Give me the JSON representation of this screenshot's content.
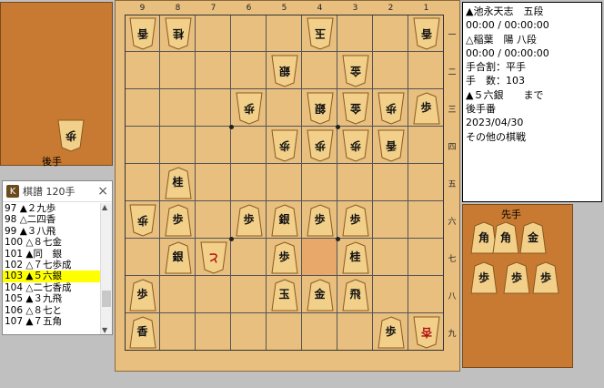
{
  "gote_stand": {
    "label": "後手",
    "pieces": [
      {
        "char": "歩",
        "count": ""
      }
    ]
  },
  "sente_stand": {
    "label": "先手",
    "pieces": [
      "角",
      "角",
      "金",
      "歩",
      "歩",
      "歩"
    ]
  },
  "info": {
    "lines": [
      "▲池永天志　五段",
      "00:00 / 00:00:00",
      "△稲葉　陽 八段",
      "00:00 / 00:00:00",
      "手合割：平手",
      "手　数：103",
      "▲５六銀　　まで",
      "後手番",
      "2023/04/30",
      "その他の棋戦"
    ]
  },
  "kifu": {
    "icon": "K",
    "title": "棋譜 120手",
    "close": "×",
    "rows": [
      "97 ▲２九歩",
      "98 △二四香",
      "99 ▲３八飛",
      "100 △８七金",
      "101 ▲同　銀",
      "102 △７七歩成",
      "103 ▲５六銀",
      "104 △二七香成",
      "105 ▲３九飛",
      "106 △８七と",
      "107 ▲７五角"
    ],
    "selected_index": 6
  },
  "board": {
    "files": [
      "9",
      "8",
      "7",
      "6",
      "5",
      "4",
      "3",
      "2",
      "1"
    ],
    "ranks": [
      "一",
      "二",
      "三",
      "四",
      "五",
      "六",
      "七",
      "八",
      "九"
    ],
    "highlight": {
      "file": 4,
      "rank": 7
    },
    "pieces": [
      {
        "file": 9,
        "rank": 1,
        "ch": "香",
        "side": "gote"
      },
      {
        "file": 8,
        "rank": 1,
        "ch": "桂",
        "side": "gote"
      },
      {
        "file": 4,
        "rank": 1,
        "ch": "玉",
        "side": "gote"
      },
      {
        "file": 1,
        "rank": 1,
        "ch": "香",
        "side": "gote"
      },
      {
        "file": 5,
        "rank": 2,
        "ch": "銀",
        "side": "gote"
      },
      {
        "file": 3,
        "rank": 2,
        "ch": "金",
        "side": "gote"
      },
      {
        "file": 6,
        "rank": 3,
        "ch": "歩",
        "side": "gote"
      },
      {
        "file": 4,
        "rank": 3,
        "ch": "銀",
        "side": "gote"
      },
      {
        "file": 3,
        "rank": 3,
        "ch": "金",
        "side": "gote"
      },
      {
        "file": 2,
        "rank": 3,
        "ch": "歩",
        "side": "gote"
      },
      {
        "file": 1,
        "rank": 3,
        "ch": "歩",
        "side": "sente"
      },
      {
        "file": 5,
        "rank": 4,
        "ch": "歩",
        "side": "gote"
      },
      {
        "file": 4,
        "rank": 4,
        "ch": "歩",
        "side": "gote"
      },
      {
        "file": 3,
        "rank": 4,
        "ch": "歩",
        "side": "gote"
      },
      {
        "file": 2,
        "rank": 4,
        "ch": "香",
        "side": "gote"
      },
      {
        "file": 8,
        "rank": 5,
        "ch": "桂",
        "side": "sente"
      },
      {
        "file": 9,
        "rank": 6,
        "ch": "歩",
        "side": "gote"
      },
      {
        "file": 8,
        "rank": 6,
        "ch": "歩",
        "side": "sente"
      },
      {
        "file": 6,
        "rank": 6,
        "ch": "歩",
        "side": "sente"
      },
      {
        "file": 5,
        "rank": 6,
        "ch": "銀",
        "side": "sente"
      },
      {
        "file": 4,
        "rank": 6,
        "ch": "歩",
        "side": "sente"
      },
      {
        "file": 3,
        "rank": 6,
        "ch": "歩",
        "side": "sente"
      },
      {
        "file": 8,
        "rank": 7,
        "ch": "銀",
        "side": "sente"
      },
      {
        "file": 7,
        "rank": 7,
        "ch": "と",
        "side": "gote",
        "promoted": true
      },
      {
        "file": 5,
        "rank": 7,
        "ch": "歩",
        "side": "sente"
      },
      {
        "file": 3,
        "rank": 7,
        "ch": "桂",
        "side": "sente"
      },
      {
        "file": 9,
        "rank": 8,
        "ch": "歩",
        "side": "sente"
      },
      {
        "file": 5,
        "rank": 8,
        "ch": "玉",
        "side": "sente"
      },
      {
        "file": 4,
        "rank": 8,
        "ch": "金",
        "side": "sente"
      },
      {
        "file": 3,
        "rank": 8,
        "ch": "飛",
        "side": "sente"
      },
      {
        "file": 9,
        "rank": 9,
        "ch": "香",
        "side": "sente"
      },
      {
        "file": 2,
        "rank": 9,
        "ch": "歩",
        "side": "sente"
      },
      {
        "file": 1,
        "rank": 9,
        "ch": "杏",
        "side": "gote",
        "promoted": true
      }
    ]
  }
}
